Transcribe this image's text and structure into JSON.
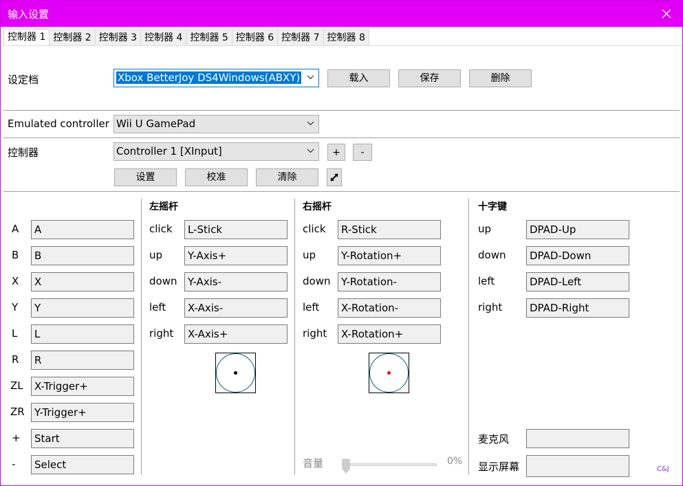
{
  "window": {
    "title": "输入设置"
  },
  "tabs": [
    "控制器 1",
    "控制器 2",
    "控制器 3",
    "控制器 4",
    "控制器 5",
    "控制器 6",
    "控制器 7",
    "控制器 8"
  ],
  "profile": {
    "label": "设定档",
    "value": "Xbox BetterJoy DS4Windows(ABXY)",
    "load": "载入",
    "save": "保存",
    "delete": "删除"
  },
  "emulated": {
    "label": "Emulated controller",
    "value": "Wii U GamePad"
  },
  "controller": {
    "label": "控制器",
    "value": "Controller 1 [XInput]",
    "add": "+",
    "remove": "-",
    "setup": "设置",
    "calibrate": "校准",
    "clear": "清除"
  },
  "buttons": [
    {
      "label": "A",
      "value": "A"
    },
    {
      "label": "B",
      "value": "B"
    },
    {
      "label": "X",
      "value": "X"
    },
    {
      "label": "Y",
      "value": "Y"
    },
    {
      "label": "L",
      "value": "L"
    },
    {
      "label": "R",
      "value": "R"
    },
    {
      "label": "ZL",
      "value": "X-Trigger+"
    },
    {
      "label": "ZR",
      "value": "Y-Trigger+"
    },
    {
      "label": "+",
      "value": "Start"
    },
    {
      "label": "-",
      "value": "Select"
    }
  ],
  "left_stick": {
    "heading": "左摇杆",
    "rows": [
      {
        "label": "click",
        "value": "L-Stick"
      },
      {
        "label": "up",
        "value": "Y-Axis+"
      },
      {
        "label": "down",
        "value": "Y-Axis-"
      },
      {
        "label": "left",
        "value": "X-Axis-"
      },
      {
        "label": "right",
        "value": "X-Axis+"
      }
    ],
    "dot_color": "#000000"
  },
  "right_stick": {
    "heading": "右摇杆",
    "rows": [
      {
        "label": "click",
        "value": "R-Stick"
      },
      {
        "label": "up",
        "value": "Y-Rotation+"
      },
      {
        "label": "down",
        "value": "Y-Rotation-"
      },
      {
        "label": "left",
        "value": "X-Rotation-"
      },
      {
        "label": "right",
        "value": "X-Rotation+"
      }
    ],
    "dot_color": "#ff0000"
  },
  "dpad": {
    "heading": "十字键",
    "rows": [
      {
        "label": "up",
        "value": "DPAD-Up"
      },
      {
        "label": "down",
        "value": "DPAD-Down"
      },
      {
        "label": "left",
        "value": "DPAD-Left"
      },
      {
        "label": "right",
        "value": "DPAD-Right"
      }
    ]
  },
  "mic": {
    "label": "麦克风",
    "value": ""
  },
  "screen": {
    "label": "显示屏幕",
    "value": ""
  },
  "volume": {
    "label": "音量",
    "value": "0%"
  },
  "footer": "C&J",
  "colors": {
    "titlebar": "#e100f5",
    "accent": "#0078d7",
    "footer": "#8a2be2"
  }
}
